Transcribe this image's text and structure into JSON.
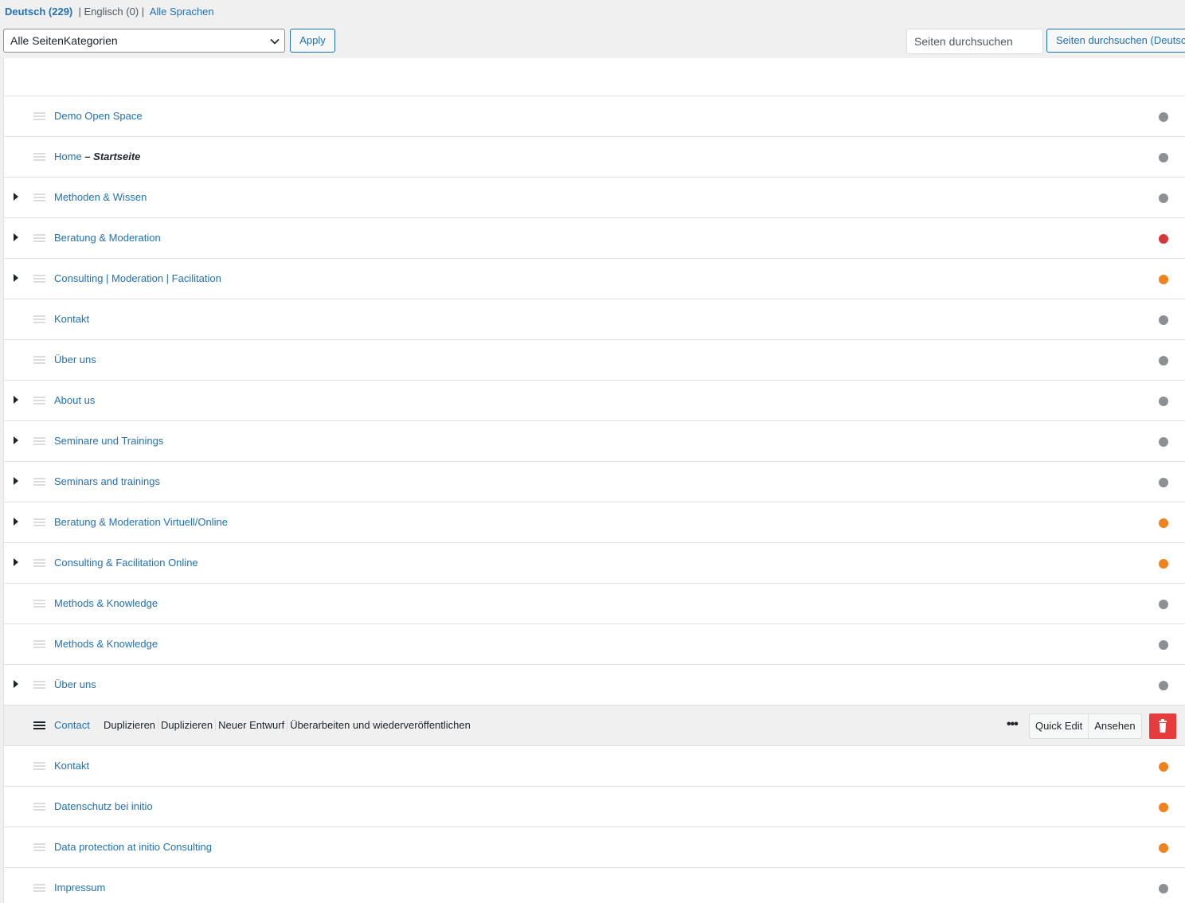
{
  "languages": {
    "current": "Deutsch (229)",
    "other": "Englisch (0)",
    "all": "Alle Sprachen",
    "separator": "|"
  },
  "filter": {
    "category_selected": "Alle SeitenKategorien",
    "apply_label": "Apply",
    "search_placeholder": "Seiten durchsuchen",
    "search_button": "Seiten durchsuchen (Deutsch)"
  },
  "status_colors": {
    "grey": "#8c8f94",
    "red": "#d63638",
    "orange": "#f0821e"
  },
  "rows": [
    {
      "title": "Demo Open Space",
      "state": "",
      "has_children": false,
      "status": "grey"
    },
    {
      "title": "Home",
      "state": "Startseite",
      "has_children": false,
      "status": "grey"
    },
    {
      "title": "Methoden & Wissen",
      "state": "",
      "has_children": true,
      "status": "grey"
    },
    {
      "title": "Beratung & Moderation",
      "state": "",
      "has_children": true,
      "status": "red"
    },
    {
      "title": "Consulting | Moderation | Facilitation",
      "state": "",
      "has_children": true,
      "status": "orange"
    },
    {
      "title": "Kontakt",
      "state": "",
      "has_children": false,
      "status": "grey"
    },
    {
      "title": "Über uns",
      "state": "",
      "has_children": false,
      "status": "grey"
    },
    {
      "title": "About us",
      "state": "",
      "has_children": true,
      "status": "grey"
    },
    {
      "title": "Seminare und Trainings",
      "state": "",
      "has_children": true,
      "status": "grey"
    },
    {
      "title": "Seminars and trainings",
      "state": "",
      "has_children": true,
      "status": "grey"
    },
    {
      "title": "Beratung & Moderation Virtuell/Online",
      "state": "",
      "has_children": true,
      "status": "orange"
    },
    {
      "title": "Consulting & Facilitation Online",
      "state": "",
      "has_children": true,
      "status": "orange"
    },
    {
      "title": "Methods & Knowledge",
      "state": "",
      "has_children": false,
      "status": "grey"
    },
    {
      "title": "Methods & Knowledge",
      "state": "",
      "has_children": false,
      "status": "grey"
    },
    {
      "title": "Über uns",
      "state": "",
      "has_children": true,
      "status": "grey"
    },
    {
      "title": "Contact",
      "state": "",
      "has_children": false,
      "status": "none",
      "hovered": true
    },
    {
      "title": "Kontakt",
      "state": "",
      "has_children": false,
      "status": "orange"
    },
    {
      "title": "Datenschutz bei initio",
      "state": "",
      "has_children": false,
      "status": "orange"
    },
    {
      "title": "Data protection at initio Consulting",
      "state": "",
      "has_children": false,
      "status": "orange"
    },
    {
      "title": "Impressum",
      "state": "",
      "has_children": false,
      "status": "grey"
    }
  ],
  "row_actions": {
    "duplicate_1": "Duplizieren",
    "duplicate_2": "Duplizieren",
    "new_draft": "Neuer Entwurf",
    "rewrite": "Überarbeiten und wiederveröffentlichen",
    "quick_edit": "Quick Edit",
    "view": "Ansehen",
    "more_icon": "ellipsis-icon",
    "trash_icon": "trash-icon"
  }
}
